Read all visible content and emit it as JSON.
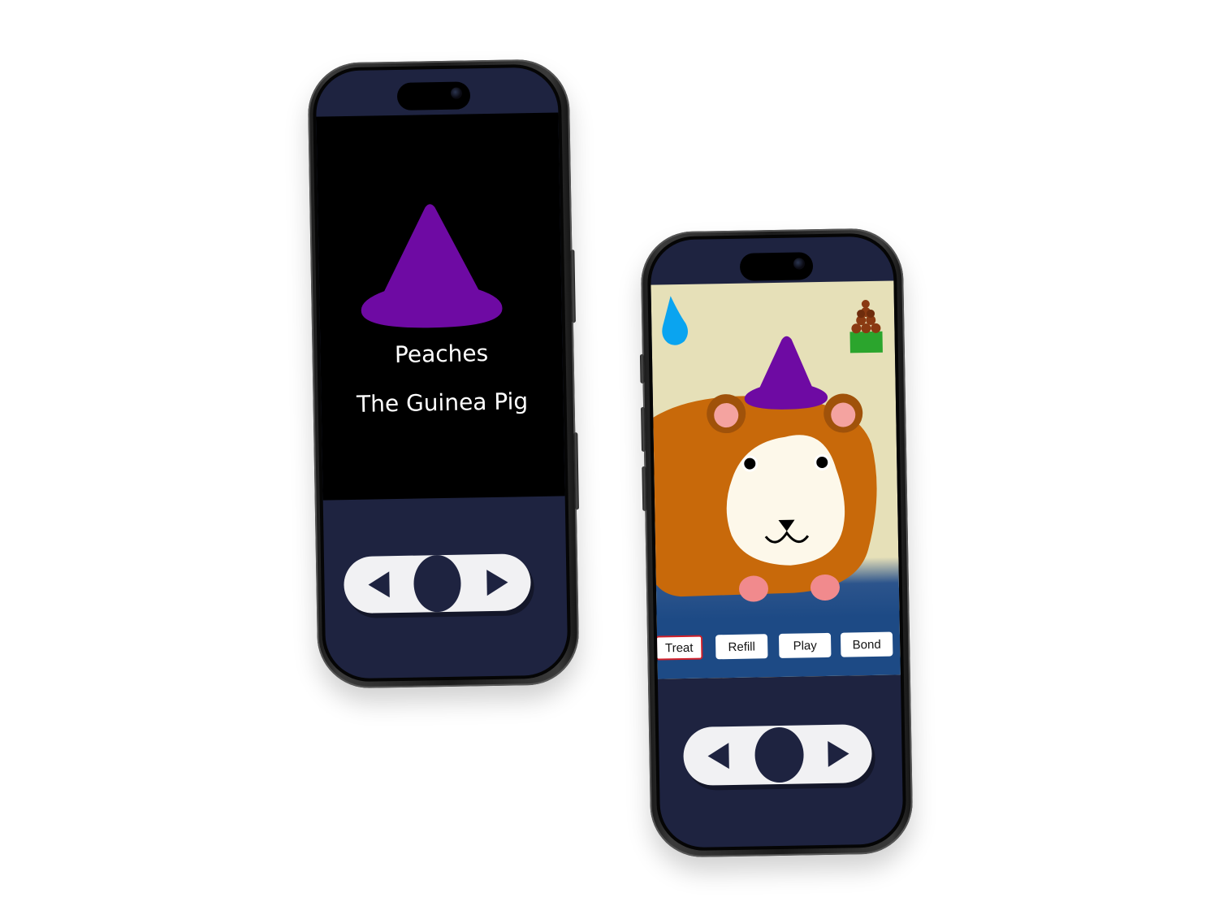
{
  "title_screen": {
    "pet_name": "Peaches",
    "pet_species": "The Guinea Pig",
    "hat_color": "#6e0aa3"
  },
  "game_screen": {
    "actions": [
      {
        "label": "Treat",
        "selected": true
      },
      {
        "label": "Refill",
        "selected": false
      },
      {
        "label": "Play",
        "selected": false
      },
      {
        "label": "Bond",
        "selected": false
      }
    ],
    "icons": {
      "water": "water-drop-icon",
      "food": "food-bowl-icon"
    }
  },
  "controller": {
    "left": "left-arrow-icon",
    "center": "select-button",
    "right": "right-arrow-icon"
  },
  "colors": {
    "device_screen_bg": "#1e2340",
    "title_bg": "#000000",
    "game_wall": "#e6e0b8",
    "game_floor": "#1d4a85",
    "pig_fur": "#c8690a",
    "selected_outline": "#d0202a"
  }
}
